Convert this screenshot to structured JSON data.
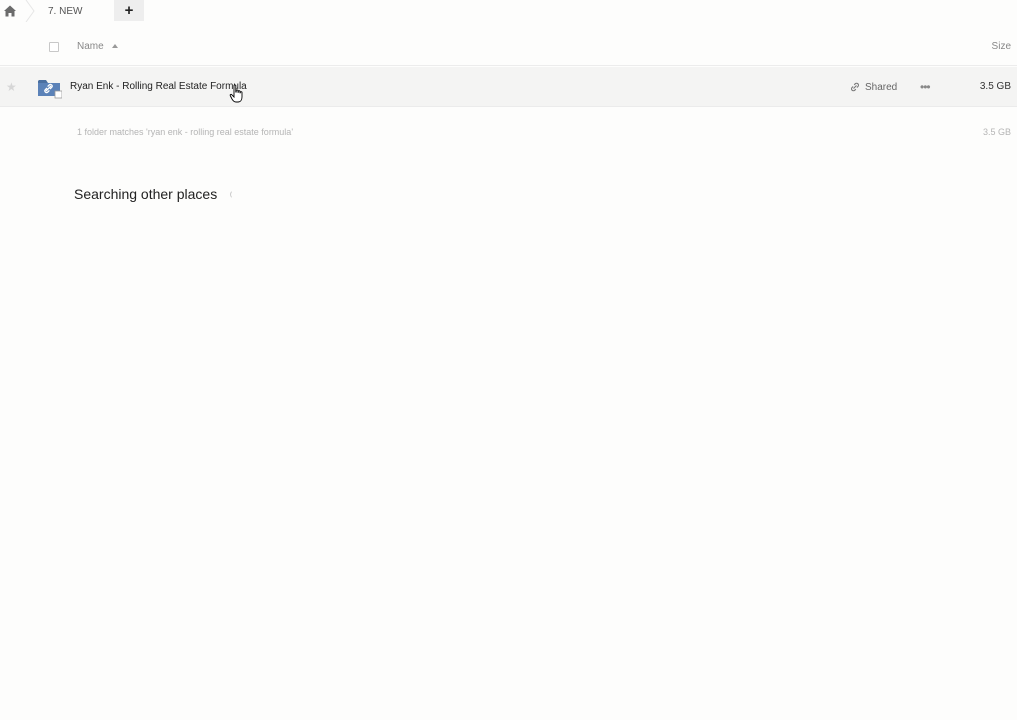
{
  "breadcrumb": {
    "current": "7. NEW",
    "add_label": "+"
  },
  "list_header": {
    "name_label": "Name",
    "size_label": "Size"
  },
  "files": [
    {
      "name": "Ryan Enk - Rolling Real Estate Formula",
      "shared_label": "Shared",
      "size": "3.5 GB"
    }
  ],
  "summary": {
    "text": "1 folder matches 'ryan enk - rolling real estate formula'",
    "size": "3.5 GB"
  },
  "searching": {
    "label": "Searching other places"
  },
  "icons": {
    "home": "home-icon",
    "add": "plus-icon",
    "sort": "sort-ascending-icon",
    "star": "star-icon",
    "folder": "shared-folder-link-icon",
    "shared": "link-icon",
    "more": "ellipsis-icon",
    "spinner": "loading-spinner-icon"
  }
}
